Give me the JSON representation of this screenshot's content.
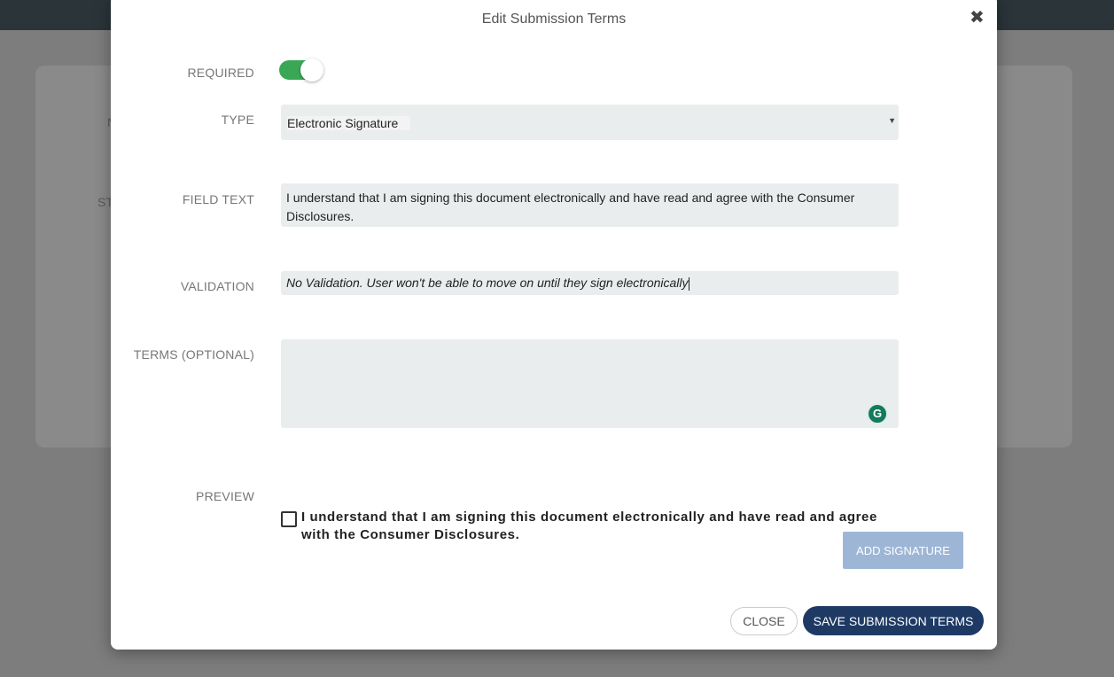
{
  "modal": {
    "title": "Edit Submission Terms",
    "close_icon": "close-icon"
  },
  "background": {
    "fragment_1": "N",
    "fragment_2": "ST"
  },
  "form": {
    "required": {
      "label": "REQUIRED",
      "enabled": true,
      "color": "#3aa757"
    },
    "type": {
      "label": "TYPE",
      "value": "Electronic Signature",
      "icon": "chevron-down-icon"
    },
    "field_text": {
      "label": "FIELD TEXT",
      "value": "I understand that I am signing this document electronically and have read and agree with the Consumer Disclosures."
    },
    "validation": {
      "label": "VALIDATION",
      "value": "No Validation. User won't be able to move on until they sign electronically"
    },
    "terms": {
      "label": "TERMS (OPTIONAL)",
      "value": "",
      "assistant_icon": "grammarly-icon"
    }
  },
  "preview": {
    "label": "PREVIEW",
    "checkbox_text": "I understand that I am signing this document electronically and have read and agree with the Consumer Disclosures.",
    "add_signature_label": "ADD SIGNATURE"
  },
  "footer": {
    "close_label": "CLOSE",
    "save_label": "SAVE SUBMISSION TERMS",
    "save_color": "#1e3a64"
  }
}
